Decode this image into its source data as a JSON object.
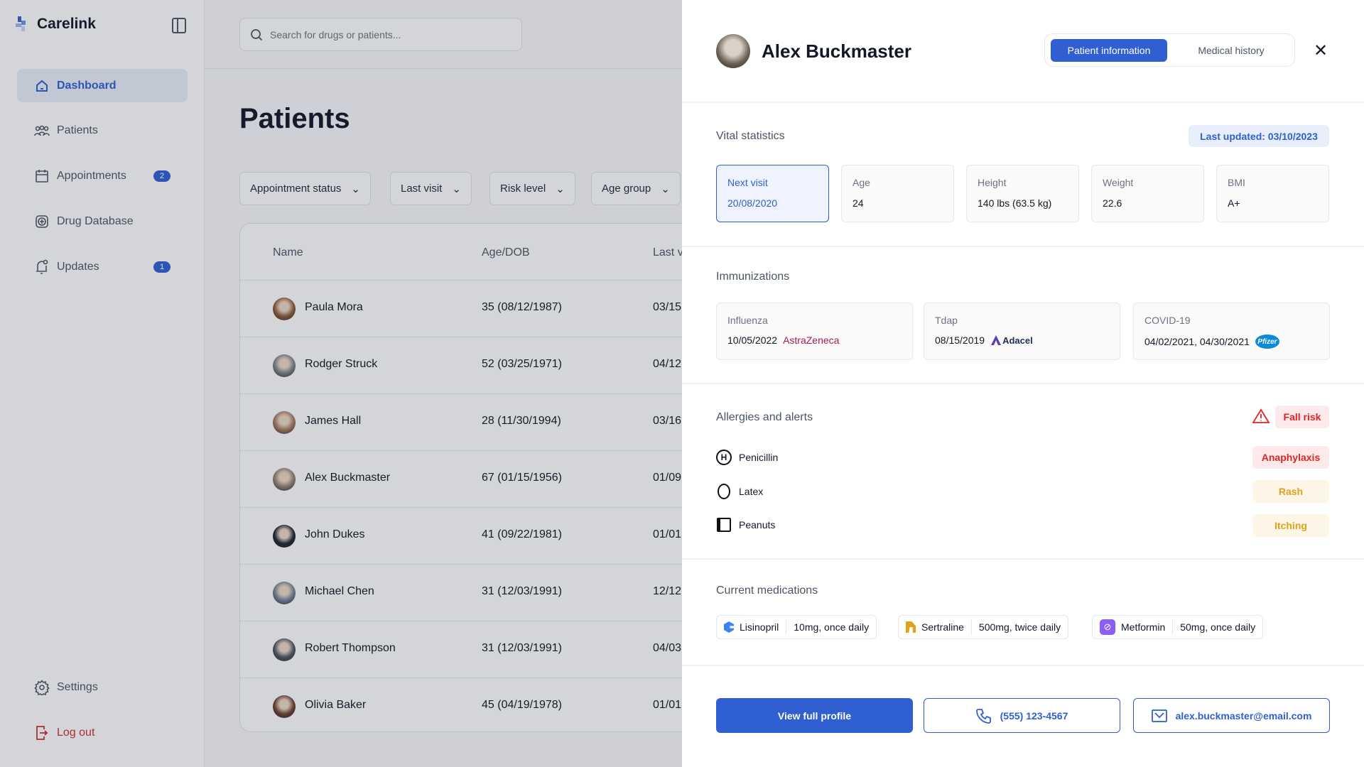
{
  "app": {
    "name": "Carelink"
  },
  "sidebar": {
    "items": [
      {
        "label": "Dashboard",
        "icon": "home-icon",
        "active": true
      },
      {
        "label": "Patients",
        "icon": "users-icon"
      },
      {
        "label": "Appointments",
        "icon": "calendar-icon",
        "badge": "2"
      },
      {
        "label": "Drug Database",
        "icon": "drug-icon"
      },
      {
        "label": "Updates",
        "icon": "bell-icon",
        "badge": "1"
      }
    ],
    "settings": "Settings",
    "logout": "Log out"
  },
  "search": {
    "placeholder": "Search for drugs or patients..."
  },
  "main": {
    "title": "Patients",
    "filters": [
      "Appointment status",
      "Last visit",
      "Risk level",
      "Age group"
    ],
    "columns": [
      "Name",
      "Age/DOB",
      "Last v"
    ],
    "rows": [
      {
        "name": "Paula Mora",
        "age": "35 (08/12/1987)",
        "last": "03/15"
      },
      {
        "name": "Rodger Struck",
        "age": "52 (03/25/1971)",
        "last": "04/12"
      },
      {
        "name": "James Hall",
        "age": "28 (11/30/1994)",
        "last": "03/16"
      },
      {
        "name": "Alex Buckmaster",
        "age": "67 (01/15/1956)",
        "last": "01/09"
      },
      {
        "name": "John Dukes",
        "age": "41 (09/22/1981)",
        "last": "01/01,"
      },
      {
        "name": "Michael Chen",
        "age": "31 (12/03/1991)",
        "last": "12/12,"
      },
      {
        "name": "Robert Thompson",
        "age": "31 (12/03/1991)",
        "last": "04/03"
      },
      {
        "name": "Olivia Baker",
        "age": "45 (04/19/1978)",
        "last": "01/01,"
      }
    ]
  },
  "panel": {
    "name": "Alex Buckmaster",
    "tabs": [
      {
        "label": "Patient information",
        "active": true
      },
      {
        "label": "Medical history"
      }
    ],
    "vitals": {
      "title": "Vital statistics",
      "updated": "Last updated: 03/10/2023",
      "cards": [
        {
          "label": "Next visit",
          "value": "20/08/2020"
        },
        {
          "label": "Age",
          "value": "24"
        },
        {
          "label": "Height",
          "value": "140 lbs (63.5 kg)"
        },
        {
          "label": "Weight",
          "value": "22.6"
        },
        {
          "label": "BMI",
          "value": "A+"
        }
      ]
    },
    "immunizations": {
      "title": "Immunizations",
      "cards": [
        {
          "label": "Influenza",
          "date": "10/05/2022",
          "brand": "AstraZeneca"
        },
        {
          "label": "Tdap",
          "date": "08/15/2019",
          "brand": "Adacel"
        },
        {
          "label": "COVID-19",
          "date": "04/02/2021, 04/30/2021",
          "brand": "Pfizer"
        }
      ]
    },
    "allergies": {
      "title": "Allergies and alerts",
      "alert": "Fall risk",
      "items": [
        {
          "name": "Penicillin",
          "reaction": "Anaphylaxis",
          "severity": "high"
        },
        {
          "name": "Latex",
          "reaction": "Rash",
          "severity": "medium"
        },
        {
          "name": "Peanuts",
          "reaction": "Itching",
          "severity": "medium"
        }
      ]
    },
    "medications": {
      "title": "Current medications",
      "items": [
        {
          "name": "Lisinopril",
          "dose": "10mg, once daily",
          "color": "#3b82f6"
        },
        {
          "name": "Sertraline",
          "dose": "500mg, twice daily",
          "color": "#e0a21b"
        },
        {
          "name": "Metformin",
          "dose": "50mg, once daily",
          "color": "#8b5cf6"
        }
      ]
    },
    "actions": {
      "profile": "View full profile",
      "phone": "(555) 123-4567",
      "email": "alex.buckmaster@email.com"
    }
  },
  "colors": {
    "accent": "#2f5fd0",
    "danger": "#dc2626",
    "warning": "#e0a21b"
  }
}
